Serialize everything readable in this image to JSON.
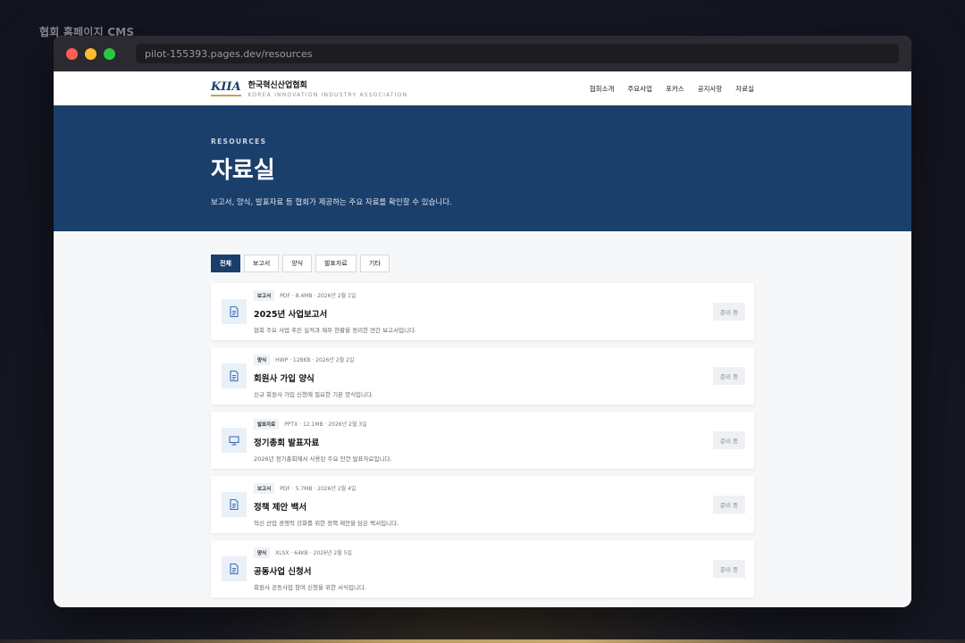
{
  "app_caption": "협회 홈페이지 CMS",
  "browser": {
    "url": "pilot-155393.pages.dev/resources"
  },
  "header": {
    "logo": "KIIA",
    "org_name": "한국혁신산업협회",
    "org_name_en": "KOREA INNOVATION INDUSTRY ASSOCIATION",
    "nav": [
      "협회소개",
      "주요사업",
      "포커스",
      "공지사항",
      "자료실"
    ]
  },
  "hero": {
    "eyebrow": "RESOURCES",
    "title": "자료실",
    "description": "보고서, 양식, 발표자료 등 협회가 제공하는 주요 자료를 확인할 수 있습니다."
  },
  "filters": [
    {
      "label": "전체",
      "active": true
    },
    {
      "label": "보고서",
      "active": false
    },
    {
      "label": "양식",
      "active": false
    },
    {
      "label": "발표자료",
      "active": false
    },
    {
      "label": "기타",
      "active": false
    }
  ],
  "resources": [
    {
      "category": "보고서",
      "meta": "PDF · 8.4MB · 2026년 2월 1일",
      "title": "2025년 사업보고서",
      "description": "협회 주요 사업 추진 실적과 재무 현황을 정리한 연간 보고서입니다.",
      "icon": "document-icon",
      "status": "준비 중"
    },
    {
      "category": "양식",
      "meta": "HWP · 128KB · 2026년 2월 2일",
      "title": "회원사 가입 양식",
      "description": "신규 회원사 가입 신청에 필요한 기본 양식입니다.",
      "icon": "document-icon",
      "status": "준비 중"
    },
    {
      "category": "발표자료",
      "meta": "PPTX · 12.1MB · 2026년 2월 3일",
      "title": "정기총회 발표자료",
      "description": "2026년 정기총회에서 사용된 주요 안건 발표자료입니다.",
      "icon": "presentation-icon",
      "status": "준비 중"
    },
    {
      "category": "보고서",
      "meta": "PDF · 5.7MB · 2026년 2월 4일",
      "title": "정책 제안 백서",
      "description": "혁신 산업 경쟁력 강화를 위한 정책 제안을 담은 백서입니다.",
      "icon": "document-icon",
      "status": "준비 중"
    },
    {
      "category": "양식",
      "meta": "XLSX · 64KB · 2026년 2월 5일",
      "title": "공동사업 신청서",
      "description": "회원사 공동사업 참여 신청을 위한 서식입니다.",
      "icon": "document-icon",
      "status": "준비 중"
    }
  ],
  "colors": {
    "primary": "#1b3f6b",
    "accent": "#c5a15a",
    "icon_blue": "#3a6fb5"
  }
}
